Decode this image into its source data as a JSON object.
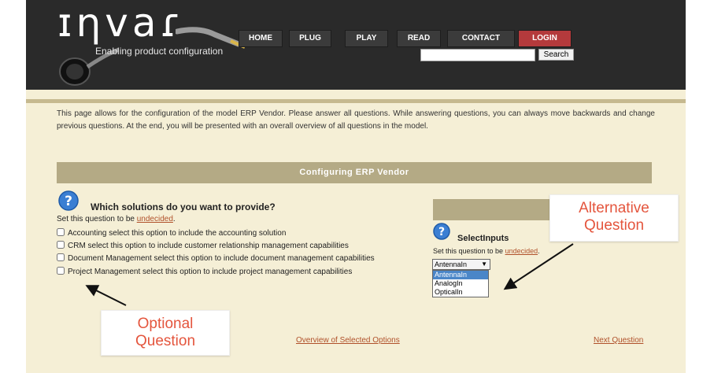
{
  "header": {
    "logo": "ɪηvaɾ",
    "tagline": "Enabling product configuration",
    "nav": [
      "HOME",
      "PLUG",
      "PLAY",
      "READ",
      "CONTACT",
      "LOGIN"
    ],
    "search_button": "Search",
    "search_value": ""
  },
  "intro": "This page allows for the configuration of the model ERP Vendor. Please answer all questions. While answering questions, you can always move backwards and change previous questions. At the end, you will be presented with an overall overview of all questions in the model.",
  "banner": "Configuring ERP Vendor",
  "question": {
    "title": "Which solutions do you want to provide?",
    "undecided_prefix": "Set this question to be ",
    "undecided_link": "undecided",
    "undecided_suffix": ".",
    "options": [
      "Accounting select this option to include the accounting solution",
      "CRM select this option to include customer relationship management capabilities",
      "Document Management select this option to include document management capabilities",
      "Project Management select this option to include project management capabilities"
    ]
  },
  "alt_question": {
    "title": "SelectInputs",
    "undecided_prefix": "Set this question to be ",
    "undecided_link": "undecided",
    "undecided_suffix": ".",
    "selected": "AntennaIn",
    "options": [
      "AntennaIn",
      "AnalogIn",
      "OpticalIn"
    ]
  },
  "callouts": {
    "alternative_1": "Alternative",
    "alternative_2": "Question",
    "optional_1": "Optional",
    "optional_2": "Question"
  },
  "footer": {
    "overview": "Overview of Selected Options",
    "next": "Next Question"
  },
  "colors": {
    "page_bg": "#f5efd6",
    "header_bg": "#2a2a2a",
    "banner": "#b4aa85",
    "login": "#b43a3c",
    "link": "#b0502a",
    "callout_text": "#e4553d"
  }
}
